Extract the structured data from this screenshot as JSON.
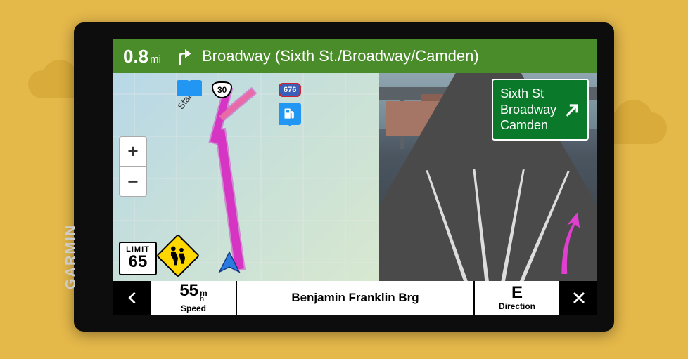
{
  "brand": "GARMIN",
  "instruction": {
    "distance_value": "0.8",
    "distance_unit": "mi",
    "maneuver": "turn-right",
    "street": "Broadway (Sixth St./Broadway/Camden)"
  },
  "map": {
    "zoom_in": "+",
    "zoom_out": "−",
    "speed_limit_label": "LIMIT",
    "speed_limit_value": "65",
    "road_shields": {
      "us_route": "30",
      "interstate": "676"
    },
    "labels": {
      "state": "State"
    },
    "poi": {
      "gas": "gas-station"
    },
    "hazard": "school-zone"
  },
  "lane_view": {
    "exit_sign": {
      "line1": "Sixth St",
      "line2": "Broadway",
      "line3": "Camden",
      "arrow": "up-right"
    }
  },
  "bottom": {
    "speed_value": "55",
    "speed_unit_top": "m",
    "speed_unit_bottom": "h",
    "speed_label": "Speed",
    "road_name": "Benjamin Franklin Brg",
    "direction_value": "E",
    "direction_label": "Direction"
  }
}
